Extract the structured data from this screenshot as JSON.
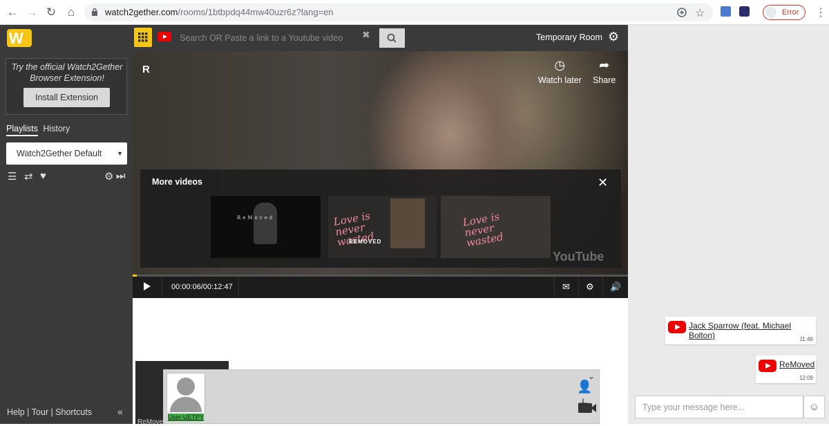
{
  "browser": {
    "url_host": "watch2gether.com",
    "url_path": "/rooms/1btbpdq44mw40uzr6z?lang=en",
    "profile_status": "Error"
  },
  "sidebar": {
    "promo_text": "Try the official Watch2Gether Browser Extension!",
    "install_label": "Install Extension",
    "tabs": [
      "Playlists",
      "History"
    ],
    "playlist_selected": "Watch2Gether Default",
    "footer": "Help | Tour | Shortcuts"
  },
  "topbar": {
    "search_placeholder": "Search OR Paste a link to a Youtube video",
    "room_name": "Temporary Room"
  },
  "player": {
    "title": "R",
    "watch_later": "Watch later",
    "share": "Share",
    "more_videos": "More videos",
    "thumb1_title": "ReMoved",
    "thumb2_title": "Love is never wasted",
    "thumb2_sub": "REMOVED",
    "thumb3_title": "Love is never wasted",
    "watermark": "YouTube",
    "time": "00:00:06/00:12:47",
    "progress": 0.008
  },
  "users": {
    "thumb_label": "ReMoved",
    "current_user": "User-UETPY"
  },
  "chat": {
    "messages": [
      {
        "title": "Jack Sparrow (feat. Michael Bolton)",
        "time": "11:46"
      },
      {
        "title": "ReMoved",
        "time": "12:09"
      }
    ],
    "input_placeholder": "Type your message here..."
  },
  "colors": {
    "brand": "#f5c518",
    "youtube": "#ee0000",
    "panel_dark": "#3a3a3a"
  }
}
